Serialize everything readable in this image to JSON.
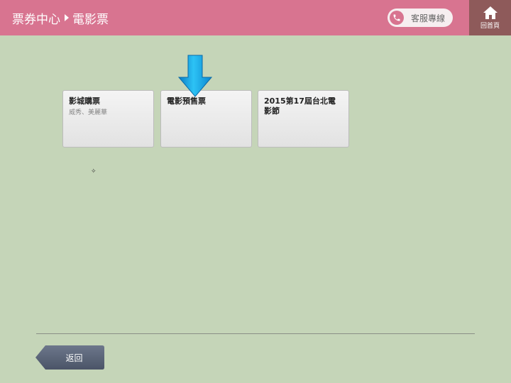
{
  "header": {
    "breadcrumb": [
      "票券中心",
      "電影票"
    ],
    "service_label": "客服專線",
    "home_label": "回首頁"
  },
  "tiles": [
    {
      "title": "影城購票",
      "subtitle": "威秀、美麗華"
    },
    {
      "title": "電影預售票",
      "subtitle": ""
    },
    {
      "title": "2015第17屆台北電影節",
      "subtitle": ""
    }
  ],
  "footer": {
    "back_label": "返回"
  },
  "colors": {
    "header_bg": "#d87490",
    "home_bg": "#8e5a5a",
    "page_bg": "#c5d5b8",
    "arrow": "#1fa8e8",
    "back_button": "#5a6478"
  },
  "icons": {
    "phone": "phone-icon",
    "home": "home-icon",
    "pointer": "arrow-down-icon",
    "back": "back-arrow-icon"
  }
}
